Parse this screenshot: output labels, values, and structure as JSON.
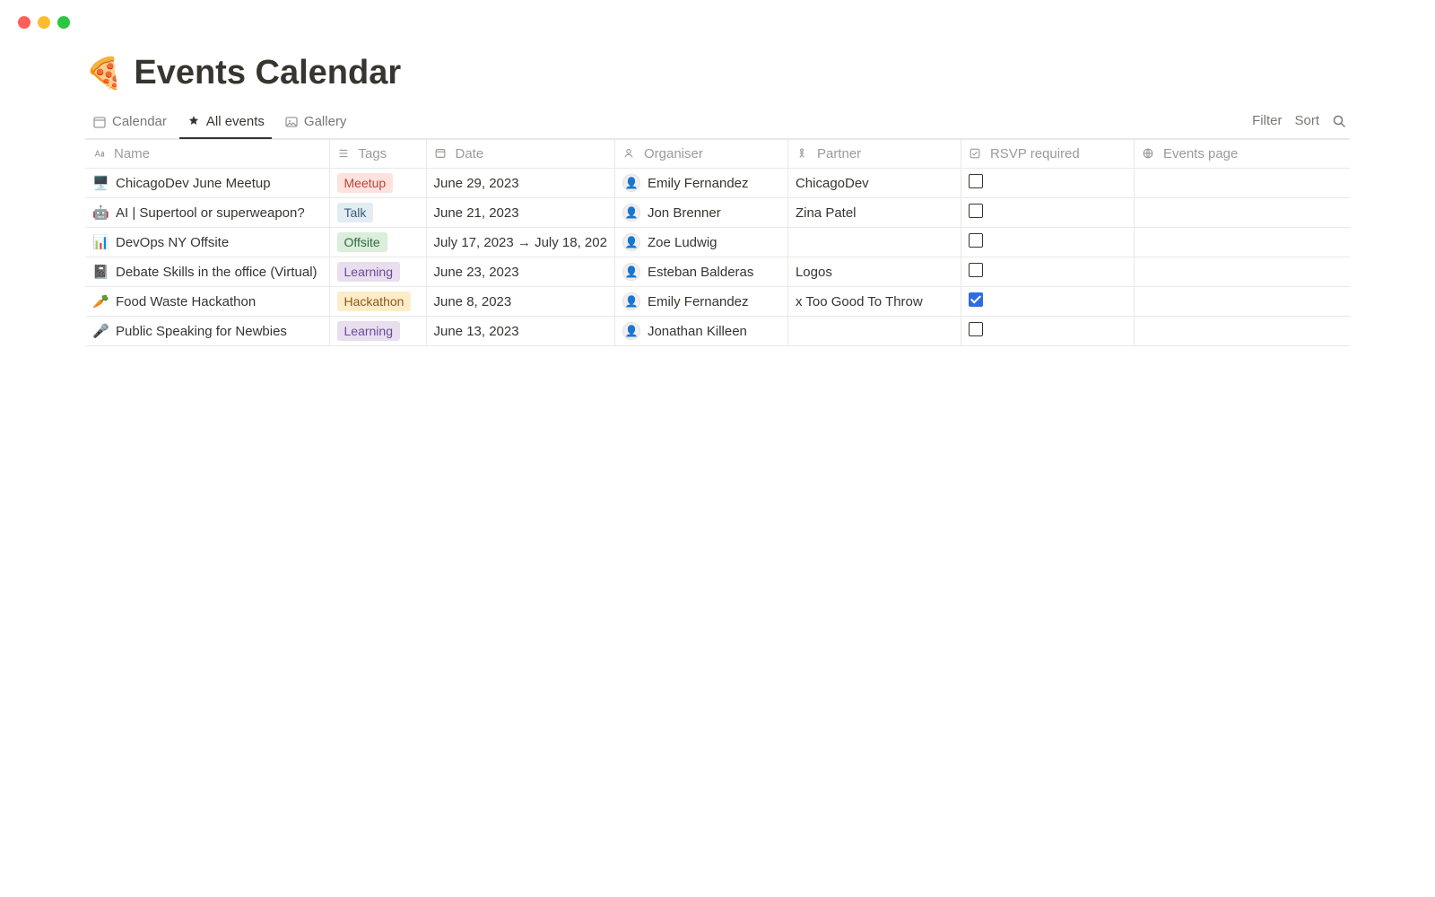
{
  "page": {
    "icon": "🍕",
    "title": "Events Calendar"
  },
  "tabs": [
    {
      "id": "calendar",
      "label": "Calendar"
    },
    {
      "id": "allevents",
      "label": "All events"
    },
    {
      "id": "gallery",
      "label": "Gallery"
    }
  ],
  "actions": {
    "filter": "Filter",
    "sort": "Sort"
  },
  "columns": {
    "name": "Name",
    "tags": "Tags",
    "date": "Date",
    "organiser": "Organiser",
    "partner": "Partner",
    "rsvp": "RSVP required",
    "events_page": "Events page"
  },
  "rows": [
    {
      "emoji": "🖥️",
      "name": "ChicagoDev June Meetup",
      "tag": {
        "label": "Meetup",
        "cls": "tag-meetup"
      },
      "date": "June 29, 2023",
      "organiser": "Emily Fernandez",
      "partner": "ChicagoDev",
      "rsvp": false
    },
    {
      "emoji": "🤖",
      "name": "AI | Supertool or superweapon?",
      "tag": {
        "label": "Talk",
        "cls": "tag-talk"
      },
      "date": "June 21, 2023",
      "organiser": "Jon Brenner",
      "partner": "Zina Patel",
      "rsvp": false
    },
    {
      "emoji": "📊",
      "name": "DevOps NY Offsite",
      "tag": {
        "label": "Offsite",
        "cls": "tag-offsite"
      },
      "date": "July 17, 2023 → July 18, 202",
      "organiser": "Zoe Ludwig",
      "partner": "",
      "rsvp": false
    },
    {
      "emoji": "📓",
      "name": "Debate Skills in the office (Virtual)",
      "tag": {
        "label": "Learning",
        "cls": "tag-learning"
      },
      "date": "June 23, 2023",
      "organiser": "Esteban Balderas",
      "partner": "Logos",
      "rsvp": false
    },
    {
      "emoji": "🥕",
      "name": "Food Waste Hackathon",
      "tag": {
        "label": "Hackathon",
        "cls": "tag-hackathon"
      },
      "date": "June 8, 2023",
      "organiser": "Emily Fernandez",
      "partner": "x Too Good To Throw",
      "rsvp": true
    },
    {
      "emoji": "🎤",
      "name": "Public Speaking for Newbies",
      "tag": {
        "label": "Learning",
        "cls": "tag-learning"
      },
      "date": "June 13, 2023",
      "organiser": "Jonathan Killeen",
      "partner": "",
      "rsvp": false
    }
  ]
}
